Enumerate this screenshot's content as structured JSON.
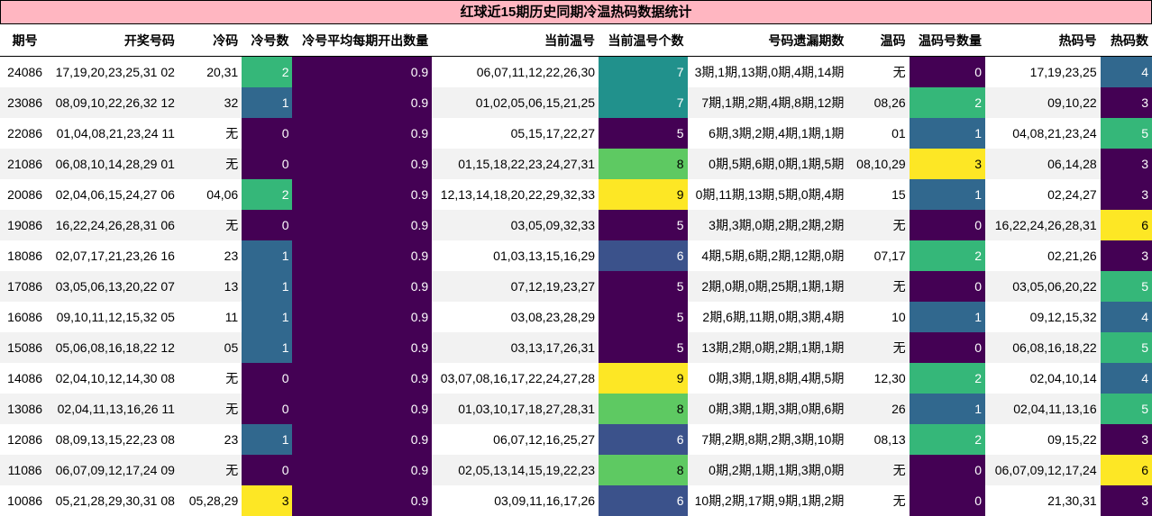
{
  "title": "红球近15期历史同期冷温热码数据统计",
  "headers": [
    "期号",
    "开奖号码",
    "冷码",
    "冷号数",
    "冷号平均每期开出数量",
    "当前温号",
    "当前温号个数",
    "号码遗漏期数",
    "温码",
    "温码号数量",
    "热码号",
    "热码数"
  ],
  "rows": [
    {
      "period": "24086",
      "numbers": "17,19,20,23,25,31 02",
      "cold": "20,31",
      "cold_count": "2",
      "avg": "0.9",
      "warm_now": "06,07,11,12,22,26,30",
      "warm_now_count": "7",
      "miss": "3期,1期,13期,0期,4期,14期",
      "warm": "无",
      "warm_count": "0",
      "hot": "17,19,23,25",
      "hot_count": "4"
    },
    {
      "period": "23086",
      "numbers": "08,09,10,22,26,32 12",
      "cold": "32",
      "cold_count": "1",
      "avg": "0.9",
      "warm_now": "01,02,05,06,15,21,25",
      "warm_now_count": "7",
      "miss": "7期,1期,2期,4期,8期,12期",
      "warm": "08,26",
      "warm_count": "2",
      "hot": "09,10,22",
      "hot_count": "3"
    },
    {
      "period": "22086",
      "numbers": "01,04,08,21,23,24 11",
      "cold": "无",
      "cold_count": "0",
      "avg": "0.9",
      "warm_now": "05,15,17,22,27",
      "warm_now_count": "5",
      "miss": "6期,3期,2期,4期,1期,1期",
      "warm": "01",
      "warm_count": "1",
      "hot": "04,08,21,23,24",
      "hot_count": "5"
    },
    {
      "period": "21086",
      "numbers": "06,08,10,14,28,29 01",
      "cold": "无",
      "cold_count": "0",
      "avg": "0.9",
      "warm_now": "01,15,18,22,23,24,27,31",
      "warm_now_count": "8",
      "miss": "0期,5期,6期,0期,1期,5期",
      "warm": "08,10,29",
      "warm_count": "3",
      "hot": "06,14,28",
      "hot_count": "3"
    },
    {
      "period": "20086",
      "numbers": "02,04,06,15,24,27 06",
      "cold": "04,06",
      "cold_count": "2",
      "avg": "0.9",
      "warm_now": "12,13,14,18,20,22,29,32,33",
      "warm_now_count": "9",
      "miss": "0期,11期,13期,5期,0期,4期",
      "warm": "15",
      "warm_count": "1",
      "hot": "02,24,27",
      "hot_count": "3"
    },
    {
      "period": "19086",
      "numbers": "16,22,24,26,28,31 06",
      "cold": "无",
      "cold_count": "0",
      "avg": "0.9",
      "warm_now": "03,05,09,32,33",
      "warm_now_count": "5",
      "miss": "3期,3期,0期,2期,2期,2期",
      "warm": "无",
      "warm_count": "0",
      "hot": "16,22,24,26,28,31",
      "hot_count": "6"
    },
    {
      "period": "18086",
      "numbers": "02,07,17,21,23,26 16",
      "cold": "23",
      "cold_count": "1",
      "avg": "0.9",
      "warm_now": "01,03,13,15,16,29",
      "warm_now_count": "6",
      "miss": "4期,5期,6期,2期,12期,0期",
      "warm": "07,17",
      "warm_count": "2",
      "hot": "02,21,26",
      "hot_count": "3"
    },
    {
      "period": "17086",
      "numbers": "03,05,06,13,20,22 07",
      "cold": "13",
      "cold_count": "1",
      "avg": "0.9",
      "warm_now": "07,12,19,23,27",
      "warm_now_count": "5",
      "miss": "2期,0期,0期,25期,1期,1期",
      "warm": "无",
      "warm_count": "0",
      "hot": "03,05,06,20,22",
      "hot_count": "5"
    },
    {
      "period": "16086",
      "numbers": "09,10,11,12,15,32 05",
      "cold": "11",
      "cold_count": "1",
      "avg": "0.9",
      "warm_now": "03,08,23,28,29",
      "warm_now_count": "5",
      "miss": "2期,6期,11期,0期,3期,4期",
      "warm": "10",
      "warm_count": "1",
      "hot": "09,12,15,32",
      "hot_count": "4"
    },
    {
      "period": "15086",
      "numbers": "05,06,08,16,18,22 12",
      "cold": "05",
      "cold_count": "1",
      "avg": "0.9",
      "warm_now": "03,13,17,26,31",
      "warm_now_count": "5",
      "miss": "13期,2期,0期,2期,1期,1期",
      "warm": "无",
      "warm_count": "0",
      "hot": "06,08,16,18,22",
      "hot_count": "5"
    },
    {
      "period": "14086",
      "numbers": "02,04,10,12,14,30 08",
      "cold": "无",
      "cold_count": "0",
      "avg": "0.9",
      "warm_now": "03,07,08,16,17,22,24,27,28",
      "warm_now_count": "9",
      "miss": "0期,3期,1期,8期,4期,5期",
      "warm": "12,30",
      "warm_count": "2",
      "hot": "02,04,10,14",
      "hot_count": "4"
    },
    {
      "period": "13086",
      "numbers": "02,04,11,13,16,26 11",
      "cold": "无",
      "cold_count": "0",
      "avg": "0.9",
      "warm_now": "01,03,10,17,18,27,28,31",
      "warm_now_count": "8",
      "miss": "0期,3期,1期,3期,0期,6期",
      "warm": "26",
      "warm_count": "1",
      "hot": "02,04,11,13,16",
      "hot_count": "5"
    },
    {
      "period": "12086",
      "numbers": "08,09,13,15,22,23 08",
      "cold": "23",
      "cold_count": "1",
      "avg": "0.9",
      "warm_now": "06,07,12,16,25,27",
      "warm_now_count": "6",
      "miss": "7期,2期,8期,2期,3期,10期",
      "warm": "08,13",
      "warm_count": "2",
      "hot": "09,15,22",
      "hot_count": "3"
    },
    {
      "period": "11086",
      "numbers": "06,07,09,12,17,24 09",
      "cold": "无",
      "cold_count": "0",
      "avg": "0.9",
      "warm_now": "02,05,13,14,15,19,22,23",
      "warm_now_count": "8",
      "miss": "0期,2期,1期,1期,3期,0期",
      "warm": "无",
      "warm_count": "0",
      "hot": "06,07,09,12,17,24",
      "hot_count": "6"
    },
    {
      "period": "10086",
      "numbers": "05,21,28,29,30,31 08",
      "cold": "05,28,29",
      "cold_count": "3",
      "avg": "0.9",
      "warm_now": "03,09,11,16,17,26",
      "warm_now_count": "6",
      "miss": "10期,2期,17期,9期,1期,2期",
      "warm": "无",
      "warm_count": "0",
      "hot": "21,30,31",
      "hot_count": "3"
    }
  ],
  "colors": {
    "title_bg": "#ffb6c1",
    "scale_0": "#440154",
    "scale_1": "#31688e",
    "scale_2": "#35b779",
    "scale_3": "#fde725"
  }
}
